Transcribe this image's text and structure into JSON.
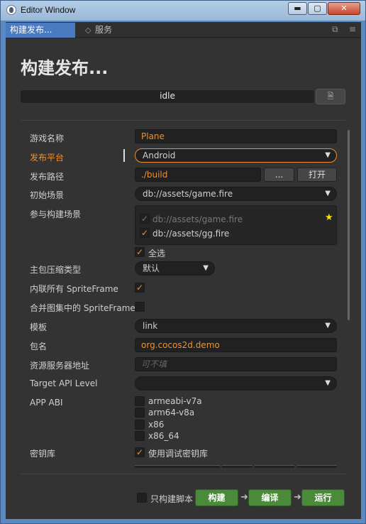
{
  "window": {
    "title": "Editor Window"
  },
  "window_buttons": {
    "minimize": "▬",
    "maximize": "▢",
    "close": "✕"
  },
  "tabs": [
    {
      "label": "构建发布...",
      "active": true
    },
    {
      "label": "服务",
      "active": false,
      "icon": "diamond-icon"
    }
  ],
  "toolbar_icons": [
    "popout-icon",
    "menu-icon"
  ],
  "page": {
    "title": "构建发布..."
  },
  "progress": {
    "status": "idle",
    "value": 0
  },
  "form": {
    "game_name": {
      "label": "游戏名称",
      "value": "Plane"
    },
    "platform": {
      "label": "发布平台",
      "value": "Android"
    },
    "build_path": {
      "label": "发布路径",
      "value": "./build",
      "browse_label": "...",
      "open_label": "打开"
    },
    "start_scene": {
      "label": "初始场景",
      "value": "db://assets/game.fire"
    },
    "included_scenes": {
      "label": "参与构建场景",
      "items": [
        {
          "label": "db://assets/game.fire",
          "checked": true,
          "disabled": true
        },
        {
          "label": "db://assets/gg.fire",
          "checked": true,
          "disabled": false
        }
      ],
      "select_all_label": "全选",
      "select_all_checked": true
    },
    "compression": {
      "label": "主包压缩类型",
      "value": "默认"
    },
    "inline_spriteframes": {
      "label": "内联所有 SpriteFrame",
      "checked": true
    },
    "merge_spriteframes": {
      "label": "合并图集中的 SpriteFrame",
      "checked": false
    },
    "template": {
      "label": "模板",
      "value": "link"
    },
    "package_name": {
      "label": "包名",
      "value": "org.cocos2d.demo"
    },
    "resource_server": {
      "label": "资源服务器地址",
      "placeholder": "可不填"
    },
    "target_api": {
      "label": "Target API Level",
      "value": ""
    },
    "app_abi": {
      "label": "APP ABI",
      "options": [
        {
          "label": "armeabi-v7a",
          "checked": false
        },
        {
          "label": "arm64-v8a",
          "checked": false
        },
        {
          "label": "x86",
          "checked": false
        },
        {
          "label": "x86_64",
          "checked": false
        }
      ]
    },
    "keystore": {
      "label": "密钥库",
      "option_label": "使用调试密钥库",
      "checked": true
    }
  },
  "footer": {
    "script_only_label": "只构建脚本",
    "script_only_checked": false,
    "build_label": "构建",
    "compile_label": "编译",
    "run_label": "运行"
  },
  "colors": {
    "accent": "#f0912e",
    "tab_active": "#4a7ac0",
    "action_green": "#4a8a3a",
    "star": "#ffe000"
  }
}
